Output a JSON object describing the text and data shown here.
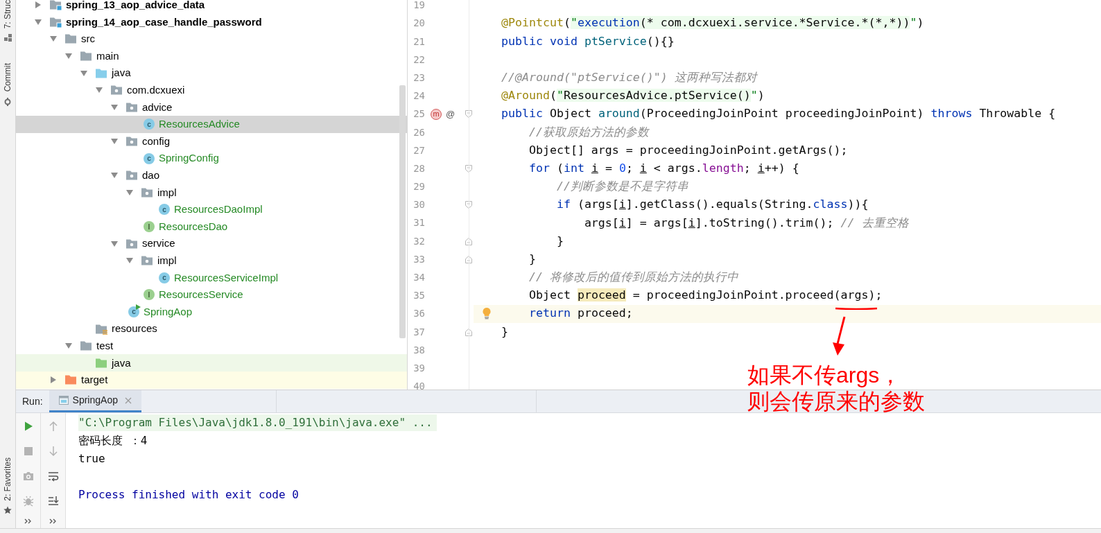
{
  "side_stripe": {
    "top": [
      {
        "label": "7: Struc",
        "kind": "structure"
      },
      {
        "label": "Commit",
        "kind": "commit"
      }
    ],
    "bottom": [
      {
        "label": "2: Favorites",
        "kind": "favorites"
      }
    ]
  },
  "project_tree": {
    "items": [
      {
        "label": "spring_13_aop_advice_data",
        "kind": "module",
        "expanded": false,
        "selected": false
      },
      {
        "label": "spring_14_aop_case_handle_password",
        "kind": "module",
        "expanded": true,
        "selected": false,
        "children": [
          {
            "label": "src",
            "kind": "folder",
            "expanded": true,
            "selected": false,
            "children": [
              {
                "label": "main",
                "kind": "folder",
                "expanded": true,
                "selected": false,
                "children": [
                  {
                    "label": "java",
                    "kind": "source_root",
                    "expanded": true,
                    "selected": false,
                    "children": [
                      {
                        "label": "com.dcxuexi",
                        "kind": "package",
                        "expanded": true,
                        "selected": false,
                        "children": [
                          {
                            "label": "advice",
                            "kind": "package",
                            "expanded": true,
                            "selected": false,
                            "children": [
                              {
                                "label": "ResourcesAdvice",
                                "kind": "class",
                                "icon_letter": "c",
                                "selected": true
                              }
                            ]
                          },
                          {
                            "label": "config",
                            "kind": "package",
                            "expanded": true,
                            "selected": false,
                            "children": [
                              {
                                "label": "SpringConfig",
                                "kind": "class",
                                "icon_letter": "c",
                                "selected": false
                              }
                            ]
                          },
                          {
                            "label": "dao",
                            "kind": "package",
                            "expanded": true,
                            "selected": false,
                            "children": [
                              {
                                "label": "impl",
                                "kind": "package",
                                "expanded": true,
                                "selected": false,
                                "children": [
                                  {
                                    "label": "ResourcesDaoImpl",
                                    "kind": "class",
                                    "icon_letter": "c",
                                    "selected": false
                                  }
                                ]
                              },
                              {
                                "label": "ResourcesDao",
                                "kind": "interface",
                                "icon_letter": "I",
                                "selected": false
                              }
                            ]
                          },
                          {
                            "label": "service",
                            "kind": "package",
                            "expanded": true,
                            "selected": false,
                            "children": [
                              {
                                "label": "impl",
                                "kind": "package",
                                "expanded": true,
                                "selected": false,
                                "children": [
                                  {
                                    "label": "ResourcesServiceImpl",
                                    "kind": "class",
                                    "icon_letter": "c",
                                    "selected": false
                                  }
                                ]
                              },
                              {
                                "label": "ResourcesService",
                                "kind": "interface",
                                "icon_letter": "I",
                                "selected": false
                              }
                            ]
                          },
                          {
                            "label": "SpringAop",
                            "kind": "main_class",
                            "icon_letter": "c",
                            "selected": false
                          }
                        ]
                      }
                    ]
                  },
                  {
                    "label": "resources",
                    "kind": "resources_root",
                    "selected": false
                  }
                ]
              },
              {
                "label": "test",
                "kind": "folder",
                "expanded": true,
                "selected": false,
                "children": [
                  {
                    "label": "java",
                    "kind": "test_root",
                    "selected": false
                  }
                ]
              }
            ]
          },
          {
            "label": "target",
            "kind": "excluded",
            "expanded": false,
            "selected": false
          }
        ]
      }
    ]
  },
  "editor": {
    "lines": [
      {
        "number": "19",
        "current": false
      },
      {
        "number": "20",
        "current": false,
        "tokens": [
          {
            "text": "@Pointcut",
            "kind": "annotation"
          },
          {
            "text": "(",
            "kind": "plain"
          },
          {
            "text": "\"",
            "kind": "injected_string"
          },
          {
            "text": "execution",
            "kind": "injected_keyword"
          },
          {
            "text": "(* com.dcxuexi.service.*Service.*(*,*))",
            "kind": "injected_plain"
          },
          {
            "text": "\"",
            "kind": "string"
          },
          {
            "text": ")",
            "kind": "plain"
          }
        ]
      },
      {
        "number": "21",
        "current": false,
        "tokens": [
          {
            "text": "public ",
            "kind": "keyword"
          },
          {
            "text": "void ",
            "kind": "keyword"
          },
          {
            "text": "ptService",
            "kind": "method"
          },
          {
            "text": "(){}",
            "kind": "plain"
          }
        ]
      },
      {
        "number": "22",
        "current": false
      },
      {
        "number": "23",
        "current": false,
        "tokens": [
          {
            "text": "//@Around(\"ptService()\") 这两种写法都对",
            "kind": "comment"
          }
        ]
      },
      {
        "number": "24",
        "current": false,
        "tokens": [
          {
            "text": "@Around",
            "kind": "annotation"
          },
          {
            "text": "(",
            "kind": "plain"
          },
          {
            "text": "\"",
            "kind": "injected_string"
          },
          {
            "text": "ResourcesAdvice.ptService()",
            "kind": "injected_plain"
          },
          {
            "text": "\"",
            "kind": "string"
          },
          {
            "text": ")",
            "kind": "plain"
          }
        ]
      },
      {
        "number": "25",
        "current": false,
        "fold": {
          "kind": "start"
        },
        "gutter_icons": [
          {
            "kind": "override",
            "glyph": "m"
          },
          {
            "kind": "annotation",
            "glyph": "@"
          }
        ],
        "tokens": [
          {
            "text": "public",
            "kind": "keyword"
          },
          {
            "text": " Object ",
            "kind": "plain"
          },
          {
            "text": "around",
            "kind": "method"
          },
          {
            "text": "(ProceedingJoinPoint proceedingJoinPoint) ",
            "kind": "plain"
          },
          {
            "text": "throws",
            "kind": "keyword"
          },
          {
            "text": " Throwable {",
            "kind": "plain"
          }
        ]
      },
      {
        "number": "26",
        "current": false,
        "tokens": [
          {
            "text": "    //获取原始方法的参数",
            "kind": "comment"
          }
        ]
      },
      {
        "number": "27",
        "current": false,
        "tokens": [
          {
            "text": "    Object[] args = proceedingJoinPoint.getArgs();",
            "kind": "plain"
          }
        ]
      },
      {
        "number": "28",
        "current": false,
        "fold": {
          "kind": "start"
        },
        "tokens": [
          {
            "text": "    for",
            "kind": "keyword"
          },
          {
            "text": " (",
            "kind": "plain"
          },
          {
            "text": "int ",
            "kind": "keyword"
          },
          {
            "text": "i",
            "kind": "reassigned"
          },
          {
            "text": " = ",
            "kind": "plain"
          },
          {
            "text": "0",
            "kind": "number"
          },
          {
            "text": "; ",
            "kind": "plain"
          },
          {
            "text": "i",
            "kind": "reassigned"
          },
          {
            "text": " < args.",
            "kind": "plain"
          },
          {
            "text": "length",
            "kind": "field"
          },
          {
            "text": "; ",
            "kind": "plain"
          },
          {
            "text": "i",
            "kind": "reassigned"
          },
          {
            "text": "++) {",
            "kind": "plain"
          }
        ]
      },
      {
        "number": "29",
        "current": false,
        "tokens": [
          {
            "text": "        //判断参数是不是字符串",
            "kind": "comment"
          }
        ]
      },
      {
        "number": "30",
        "current": false,
        "fold": {
          "kind": "start"
        },
        "tokens": [
          {
            "text": "        if",
            "kind": "keyword"
          },
          {
            "text": " (args[",
            "kind": "plain"
          },
          {
            "text": "i",
            "kind": "reassigned"
          },
          {
            "text": "].getClass().equals(String.",
            "kind": "plain"
          },
          {
            "text": "class",
            "kind": "keyword"
          },
          {
            "text": ")){",
            "kind": "plain"
          }
        ]
      },
      {
        "number": "31",
        "current": false,
        "tokens": [
          {
            "text": "            args[",
            "kind": "plain"
          },
          {
            "text": "i",
            "kind": "reassigned"
          },
          {
            "text": "] = args[",
            "kind": "plain"
          },
          {
            "text": "i",
            "kind": "reassigned"
          },
          {
            "text": "].toString().trim(); ",
            "kind": "plain"
          },
          {
            "text": "// 去重空格",
            "kind": "comment"
          }
        ]
      },
      {
        "number": "32",
        "current": false,
        "fold": {
          "kind": "end"
        },
        "tokens": [
          {
            "text": "        }",
            "kind": "plain"
          }
        ]
      },
      {
        "number": "33",
        "current": false,
        "fold": {
          "kind": "end"
        },
        "tokens": [
          {
            "text": "    }",
            "kind": "plain"
          }
        ]
      },
      {
        "number": "34",
        "current": false,
        "tokens": [
          {
            "text": "    // 将修改后的值传到原始方法的执行中",
            "kind": "comment"
          }
        ]
      },
      {
        "number": "35",
        "current": false,
        "tokens": [
          {
            "text": "    Object ",
            "kind": "plain"
          },
          {
            "text": "proceed",
            "kind": "usage"
          },
          {
            "text": " = proceedingJoinPoint.proceed(args);",
            "kind": "plain"
          }
        ]
      },
      {
        "number": "36",
        "current": true,
        "bulb": true,
        "tokens": [
          {
            "text": "    return",
            "kind": "keyword"
          },
          {
            "text": " proceed;",
            "kind": "plain"
          }
        ]
      },
      {
        "number": "37",
        "current": false,
        "fold": {
          "kind": "end"
        },
        "tokens": [
          {
            "text": "}",
            "kind": "plain"
          }
        ]
      },
      {
        "number": "38",
        "current": false
      },
      {
        "number": "39",
        "current": false
      },
      {
        "number": "40",
        "current": false
      }
    ]
  },
  "callout": {
    "lines": [
      "如果不传args，",
      "则会传原来的参数"
    ],
    "color": "#ff0000"
  },
  "run_panel": {
    "label": "Run:",
    "tabs": [
      {
        "title": "SpringAop",
        "selected": true
      }
    ],
    "toolbar_left": [
      {
        "kind": "run",
        "disabled": false
      },
      {
        "kind": "stop",
        "disabled": true
      },
      {
        "kind": "snapshot",
        "disabled": true
      },
      {
        "kind": "debug",
        "disabled": true
      },
      {
        "kind": "more",
        "disabled": false
      }
    ],
    "toolbar_right": [
      {
        "kind": "up",
        "disabled": true
      },
      {
        "kind": "down",
        "disabled": true
      },
      {
        "kind": "wrap",
        "disabled": false
      },
      {
        "kind": "scroll_end",
        "disabled": false
      },
      {
        "kind": "more",
        "disabled": false
      }
    ],
    "console": [
      {
        "text": "\"C:\\Program Files\\Java\\jdk1.8.0_191\\bin\\java.exe\" ...",
        "kind": "command"
      },
      {
        "text": "密码长度 ：4",
        "kind": "output"
      },
      {
        "text": "true",
        "kind": "output"
      },
      {
        "text": "Process finished with exit code 0",
        "kind": "exit"
      }
    ]
  }
}
